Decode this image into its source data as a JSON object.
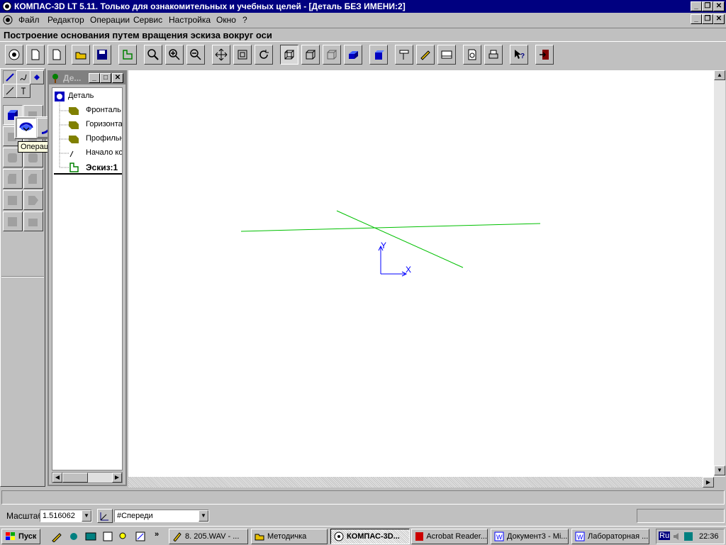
{
  "window": {
    "title": "КОМПАС-3D LT 5.11. Только для ознакомительных и учебных целей - [Деталь БЕЗ ИМЕНИ:2]"
  },
  "menu": {
    "items": [
      "Файл",
      "Редактор",
      "Операции",
      "Сервис",
      "Настройка",
      "Окно",
      "?"
    ]
  },
  "prompt": {
    "text": "Построение основания путем вращения эскиза вокруг оси"
  },
  "tree": {
    "caption": "Де...",
    "items": [
      {
        "label": "Деталь"
      },
      {
        "label": "Фронталь"
      },
      {
        "label": "Горизонта"
      },
      {
        "label": "Профильн"
      },
      {
        "label": "Начало ко"
      },
      {
        "label": "Эскиз:1"
      }
    ]
  },
  "tooltip": {
    "text": "Операция вращения"
  },
  "canvas": {
    "axis_x_label": "X",
    "axis_y_label": "Y",
    "sketch_color": "#00c000",
    "axis_color": "#0000ff"
  },
  "status": {
    "scale_label": "Масштаб",
    "scale_value": "1.516062",
    "view_value": "#Спереди"
  },
  "taskbar": {
    "start_label": "Пуск",
    "tasks": [
      {
        "label": "8. 205.WAV - ..."
      },
      {
        "label": "Методичка"
      },
      {
        "label": "КОМПАС-3D..."
      },
      {
        "label": "Acrobat Reader..."
      },
      {
        "label": "Документ3 - Mi..."
      },
      {
        "label": "Лабораторная ..."
      }
    ],
    "lang": "Ru",
    "clock": "22:36"
  },
  "colors": {
    "titlebar": "#000080",
    "face": "#c0c0c0",
    "tooltip": "#ffffe1"
  }
}
